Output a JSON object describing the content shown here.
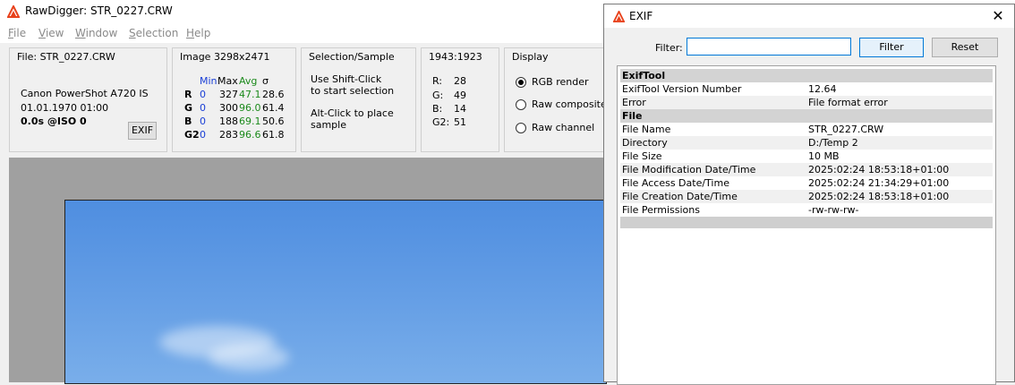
{
  "window": {
    "title": "RawDigger: STR_0227.CRW"
  },
  "menu": {
    "items": [
      {
        "label": "File",
        "ul": "F",
        "rest": "ile"
      },
      {
        "label": "View",
        "ul": "V",
        "rest": "iew"
      },
      {
        "label": "Window",
        "ul": "W",
        "rest": "indow"
      },
      {
        "label": "Selection",
        "ul": "S",
        "rest": "election"
      },
      {
        "label": "Help",
        "ul": "H",
        "rest": "elp"
      }
    ]
  },
  "file_panel": {
    "title": "File: STR_0227.CRW",
    "camera": "Canon PowerShot A720 IS",
    "date": "01.01.1970 01:00",
    "exposure": "0.0s @ISO 0",
    "exif_button": "EXIF"
  },
  "image_panel": {
    "title": "Image 3298x2471",
    "headers": {
      "min": "Min",
      "max": "Max",
      "avg": "Avg",
      "sigma": "σ"
    },
    "rows": [
      {
        "ch": "R",
        "min": "0",
        "max": "327",
        "avg": "47.1",
        "sigma": "28.6"
      },
      {
        "ch": "G",
        "min": "0",
        "max": "300",
        "avg": "96.0",
        "sigma": "61.4"
      },
      {
        "ch": "B",
        "min": "0",
        "max": "188",
        "avg": "69.1",
        "sigma": "50.6"
      },
      {
        "ch": "G2",
        "min": "0",
        "max": "283",
        "avg": "96.6",
        "sigma": "61.8"
      }
    ]
  },
  "selection_panel": {
    "title": "Selection/Sample",
    "hint1a": "Use Shift-Click",
    "hint1b": "to start selection",
    "hint2a": "Alt-Click to place",
    "hint2b": "sample"
  },
  "coords_panel": {
    "title": "1943:1923",
    "values": [
      {
        "label": "R:",
        "value": "28"
      },
      {
        "label": "G:",
        "value": "49"
      },
      {
        "label": "B:",
        "value": "14"
      },
      {
        "label": "G2:",
        "value": "51"
      }
    ]
  },
  "display_panel": {
    "title": "Display",
    "options": [
      {
        "label": "RGB render",
        "checked": true
      },
      {
        "label": "Raw composite",
        "checked": false
      },
      {
        "label": "Raw channel",
        "checked": false
      }
    ]
  },
  "exif_dialog": {
    "title": "EXIF",
    "close": "✕",
    "filter_label": "Filter:",
    "filter_value": "",
    "filter_button": "Filter",
    "reset_button": "Reset",
    "rows": [
      {
        "type": "section",
        "key": "ExifTool",
        "value": ""
      },
      {
        "type": "row",
        "key": "ExifTool Version Number",
        "value": "12.64"
      },
      {
        "type": "row",
        "key": "Error",
        "value": "File format error"
      },
      {
        "type": "section",
        "key": "File",
        "value": ""
      },
      {
        "type": "row",
        "key": "File Name",
        "value": "STR_0227.CRW"
      },
      {
        "type": "row",
        "key": "Directory",
        "value": "D:/Temp 2"
      },
      {
        "type": "row",
        "key": "File Size",
        "value": "10 MB"
      },
      {
        "type": "row",
        "key": "File Modification Date/Time",
        "value": "2025:02:24 18:53:18+01:00"
      },
      {
        "type": "row",
        "key": "File Access Date/Time",
        "value": "2025:02:24 21:34:29+01:00"
      },
      {
        "type": "row",
        "key": "File Creation Date/Time",
        "value": "2025:02:24 18:53:18+01:00"
      },
      {
        "type": "row",
        "key": "File Permissions",
        "value": "-rw-rw-rw-"
      }
    ]
  },
  "colors": {
    "accent": "#0078d7",
    "min_label": "#1a3fd6",
    "avg_label": "#1c8a1c",
    "logo": "#e8421c"
  }
}
